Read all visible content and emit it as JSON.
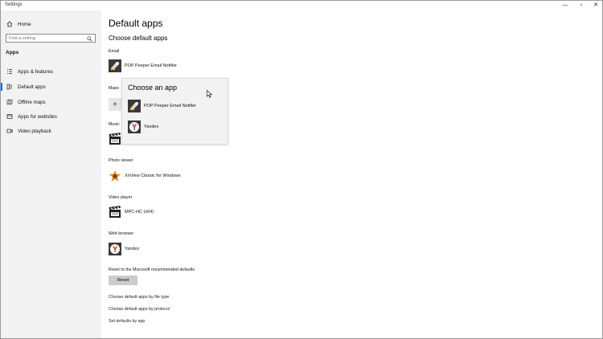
{
  "window": {
    "title": "Settings",
    "minimize_glyph": "—",
    "maximize_glyph": "▫",
    "close_glyph": "✕"
  },
  "sidebar": {
    "home_label": "Home",
    "search": {
      "placeholder": "Find a setting",
      "value": ""
    },
    "section_label": "Apps",
    "items": [
      {
        "label": "Apps & features",
        "icon": "list-icon"
      },
      {
        "label": "Default apps",
        "icon": "default-apps-icon",
        "active": true
      },
      {
        "label": "Offline maps",
        "icon": "map-icon"
      },
      {
        "label": "Apps for websites",
        "icon": "website-icon"
      },
      {
        "label": "Video playback",
        "icon": "video-icon"
      }
    ]
  },
  "main": {
    "title": "Default apps",
    "subtitle": "Choose default apps",
    "categories": [
      {
        "label": "Email",
        "app": "POP Peeper Email Notifier",
        "icon": "pop-peeper-icon"
      },
      {
        "label": "Maps",
        "app": "",
        "icon": "plus-icon"
      },
      {
        "label": "Music",
        "app": "",
        "icon": "clapper-icon"
      },
      {
        "label": "Photo viewer",
        "app": "XnView Classic for Windows",
        "icon": "xnview-icon"
      },
      {
        "label": "Video player",
        "app": "MPC-HC (x64)",
        "icon": "clapper-icon"
      },
      {
        "label": "Web browser",
        "app": "Yandex",
        "icon": "yandex-icon"
      }
    ],
    "reset": {
      "label": "Reset to the Microsoft recommended defaults",
      "button": "Reset"
    },
    "links": [
      "Choose default apps by file type",
      "Choose default apps by protocol",
      "Set defaults by app"
    ]
  },
  "popup": {
    "title": "Choose an app",
    "options": [
      {
        "label": "POP Peeper Email Notifier",
        "icon": "pop-peeper-icon"
      },
      {
        "label": "Yandex",
        "icon": "yandex-icon"
      }
    ]
  },
  "colors": {
    "accent": "#0078d7",
    "sidebar_bg": "#f2f2f2",
    "button_bg": "#cccccc",
    "yandex_red": "#e8322a"
  }
}
